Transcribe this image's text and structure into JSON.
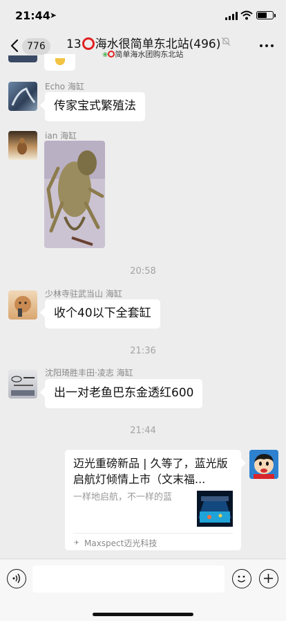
{
  "status_bar": {
    "time": "21:44",
    "location_icon": "location-arrow-icon",
    "signal_icon": "cellular-signal-icon",
    "wifi_icon": "wifi-icon",
    "battery_icon": "battery-icon"
  },
  "nav": {
    "back_icon": "chevron-left-icon",
    "unread_count": "776",
    "title_prefix": "13",
    "title_suffix": "海水很简单东北站(496)",
    "mute_icon": "bell-muted-icon",
    "subtitle": "简单海水团购东北站",
    "more_icon": "more-dots-icon"
  },
  "messages": [
    {
      "sender": "Echo 海缸",
      "text": "传家宝式繁殖法"
    },
    {
      "sender": "ian 海缸",
      "image": "crab-molt-photo"
    },
    {
      "time": "20:58"
    },
    {
      "sender": "少林寺驻武当山 海缸",
      "text": "收个40以下全套缸"
    },
    {
      "time": "21:36"
    },
    {
      "sender": "沈阳琦胜丰田·凌志 海缸",
      "text": "出一对老鱼巴东金透红600"
    },
    {
      "time": "21:44"
    }
  ],
  "link_card": {
    "title": "迈光重磅新品 | 久等了，蓝光版启航灯倾情上市（文末福...",
    "description": "一样地启航，不一样的蓝",
    "source": "Maxspect迈光科技",
    "thumbnail": "aquarium-light-thumbnail"
  },
  "input_bar": {
    "voice_icon": "voice-icon",
    "input_value": "",
    "emoji_icon": "emoji-icon",
    "plus_icon": "plus-icon"
  },
  "colors": {
    "background": "#ededed",
    "bubble": "#ffffff",
    "ring_red": "#e02020"
  }
}
